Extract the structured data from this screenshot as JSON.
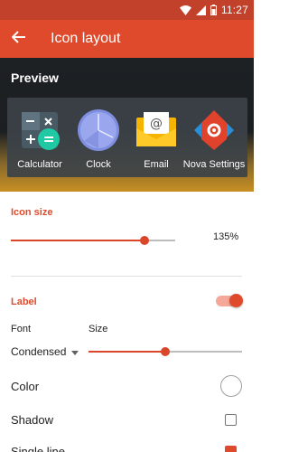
{
  "status_bar": {
    "time": "11:27"
  },
  "app_bar": {
    "title": "Icon layout"
  },
  "preview": {
    "label": "Preview",
    "apps": [
      {
        "name": "Calculator",
        "icon": "calculator-icon"
      },
      {
        "name": "Clock",
        "icon": "clock-icon"
      },
      {
        "name": "Email",
        "icon": "email-icon"
      },
      {
        "name": "Nova Settings",
        "icon": "nova-settings-icon"
      }
    ]
  },
  "icon_size": {
    "title": "Icon size",
    "value": "135%",
    "level": 0.82
  },
  "label_section": {
    "title": "Label",
    "enabled": true,
    "font": {
      "label": "Font",
      "value": "Condensed"
    },
    "size": {
      "label": "Size",
      "level": 0.5
    },
    "color": {
      "label": "Color",
      "value": "#ffffff"
    },
    "shadow": {
      "label": "Shadow",
      "checked": false
    },
    "single_line": {
      "label": "Single line",
      "checked": true
    }
  },
  "colors": {
    "accent": "#de4a2b",
    "status_bar": "#c2412a",
    "track": "#bdbdbd"
  }
}
